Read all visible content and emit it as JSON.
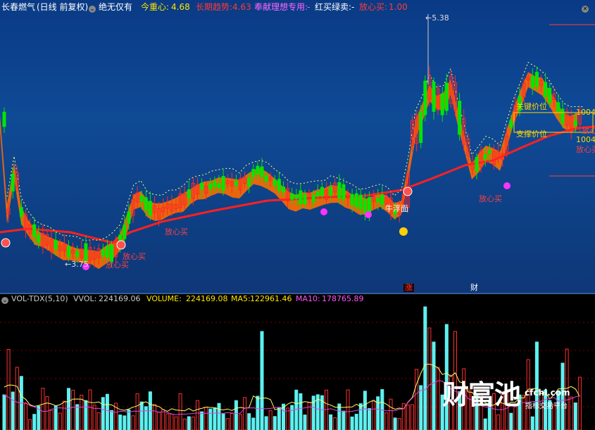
{
  "header": {
    "stock_name": "长春燃气",
    "period": "(日线 前复权)",
    "indicator_name": "绝无仅有",
    "today_center_label": "今重心:",
    "today_center_value": "4.68",
    "long_trend_label": "长期趋势:",
    "long_trend_value": "4.63",
    "dedicated_label": "奉献理想专用:",
    "dedicated_value": "-",
    "red_buy_green_sell_label": "红买绿卖:",
    "red_buy_green_sell_value": "-",
    "safe_buy_label": "放心买:",
    "safe_buy_value": "1.00"
  },
  "price_chart": {
    "high_marker": "5.38",
    "low_marker": "3.75",
    "buy_signal_label": "放心买",
    "buy_signal_short": "放心",
    "float_label": "牛浮面",
    "key_price_label": "关键价位",
    "support_price_label": "支撑价位",
    "right_value_1": "1004",
    "right_value_2": "1004",
    "bottom_char_1": "涨",
    "bottom_char_2": "财"
  },
  "volume_header": {
    "indicator": "VOL-TDX(5,10)",
    "vvol_label": "VVOL:",
    "vvol_value": "224169.06",
    "volume_label": "VOLUME:",
    "volume_value": "224169.08",
    "ma5_label": "MA5:",
    "ma5_value": "122961.46",
    "ma10_label": "MA10:",
    "ma10_value": "178765.89"
  },
  "watermark": {
    "brand": "财富池",
    "site": "cfchi.com",
    "slogan": "指标交易平台"
  },
  "colors": {
    "up_candle": "#ff2828",
    "down_candle": "#00e600",
    "long_trend_line": "#ff2020",
    "band_fill": "#ff6a00",
    "volume_up": "#ff3030",
    "volume_down": "#5ef0f0",
    "ma5_line": "#ffff66",
    "ma10_line": "#dd44dd"
  }
}
